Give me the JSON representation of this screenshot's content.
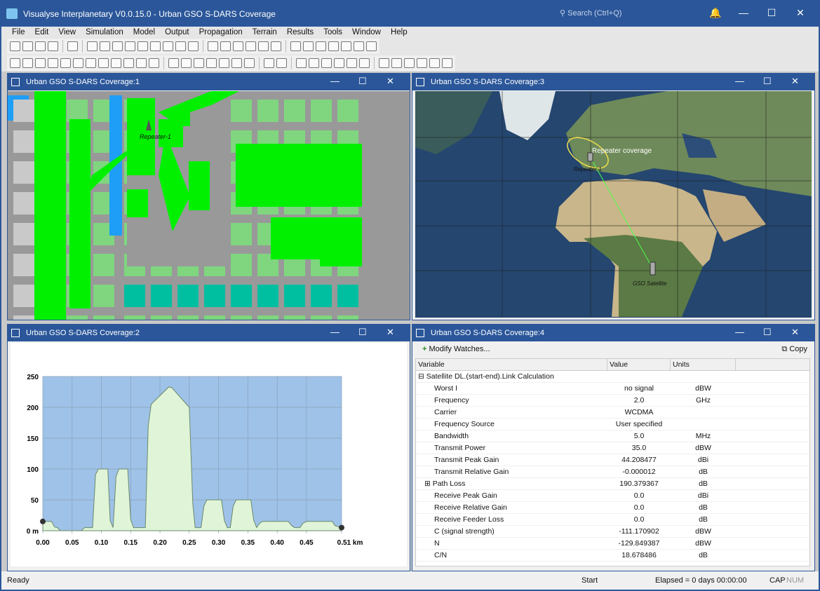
{
  "app": {
    "title": "Visualyse Interplanetary V0.0.15.0 - Urban GSO S-DARS Coverage",
    "search_placeholder": "Search (Ctrl+Q)"
  },
  "menu": [
    "File",
    "Edit",
    "View",
    "Simulation",
    "Model",
    "Output",
    "Propagation",
    "Terrain",
    "Results",
    "Tools",
    "Window",
    "Help"
  ],
  "toolbar1": [
    "new",
    "open",
    "save",
    "save-as",
    "|",
    "copy",
    "|",
    "pane-p",
    "pane-m",
    "pane-globe",
    "pane-network",
    "pane-link",
    "pane-terrain",
    "pane-table",
    "pane-chart",
    "pane-watch",
    "|",
    "select",
    "select-multi",
    "select-box",
    "zoom-in",
    "zoom-out",
    "zoom-fit",
    "|",
    "clock",
    "step-back",
    "stop",
    "step",
    "play",
    "fast-forward",
    "info"
  ],
  "toolbar2": [
    "antenna",
    "station",
    "pattern",
    "beam",
    "link",
    "grid",
    "arrow",
    "network",
    "swap",
    "cloud",
    "dropdown",
    "variable",
    "|",
    "add-station",
    "link-station",
    "link-group",
    "user",
    "user-add",
    "server",
    "server-link",
    "|",
    "sum",
    "add-doc",
    "|",
    "report",
    "filter",
    "add-filter",
    "chart-line",
    "chart-multi",
    "chart-bar",
    "|",
    "terrain",
    "terrain-add",
    "path-add",
    "path-select",
    "building-add",
    "building-filter"
  ],
  "windows": {
    "w1": {
      "title": "Urban GSO S-DARS Coverage:1",
      "repeater_label": "Repeater-1"
    },
    "w3": {
      "title": "Urban GSO S-DARS Coverage:3",
      "coverage_label": "Repeater coverage",
      "station_label": "Repeater-1",
      "satellite_label": "GSO Satellite"
    },
    "w2": {
      "title": "Urban GSO S-DARS Coverage:2"
    },
    "w4": {
      "title": "Urban GSO S-DARS Coverage:4",
      "modify_label": "Modify Watches...",
      "copy_label": "Copy",
      "columns": [
        "Variable",
        "Value",
        "Units"
      ],
      "group": "Satellite DL.(start-end).Link Calculation",
      "rows": [
        [
          "Worst I",
          "no signal",
          "dBW"
        ],
        [
          "Frequency",
          "2.0",
          "GHz"
        ],
        [
          "Carrier",
          "WCDMA",
          ""
        ],
        [
          "Frequency Source",
          "User specified",
          ""
        ],
        [
          "Bandwidth",
          "5.0",
          "MHz"
        ],
        [
          "Transmit Power",
          "35.0",
          "dBW"
        ],
        [
          "Transmit Peak Gain",
          "44.208477",
          "dBi"
        ],
        [
          "Transmit Relative Gain",
          "-0.000012",
          "dB"
        ],
        [
          "Path Loss",
          "190.379367",
          "dB"
        ],
        [
          "Receive Peak Gain",
          "0.0",
          "dBi"
        ],
        [
          "Receive Relative Gain",
          "0.0",
          "dB"
        ],
        [
          "Receive Feeder Loss",
          "0.0",
          "dB"
        ],
        [
          "C (signal strength)",
          "-111.170902",
          "dBW"
        ],
        [
          "N",
          "-129.849387",
          "dBW"
        ],
        [
          "C/N",
          "18.678486",
          "dB"
        ]
      ]
    }
  },
  "chart_data": {
    "type": "area",
    "xlabel_unit": "km",
    "ylabel_unit": "m",
    "xlim": [
      0,
      0.51
    ],
    "ylim": [
      0,
      250
    ],
    "xticks": [
      "0.00",
      "0.05",
      "0.10",
      "0.15",
      "0.20",
      "0.25",
      "0.30",
      "0.35",
      "0.40",
      "0.45",
      "0.51 km"
    ],
    "xtick_values": [
      0,
      0.05,
      0.1,
      0.15,
      0.2,
      0.25,
      0.3,
      0.35,
      0.4,
      0.45,
      0.51
    ],
    "yticks": [
      "0 m",
      "50",
      "100",
      "150",
      "200",
      "250"
    ],
    "ytick_values": [
      0,
      50,
      100,
      150,
      200,
      250
    ],
    "grid": true,
    "x": [
      0,
      0.015,
      0.02,
      0.025,
      0.03,
      0.066,
      0.071,
      0.085,
      0.09,
      0.095,
      0.111,
      0.115,
      0.12,
      0.125,
      0.13,
      0.145,
      0.15,
      0.155,
      0.175,
      0.18,
      0.185,
      0.215,
      0.22,
      0.25,
      0.256,
      0.26,
      0.27,
      0.275,
      0.28,
      0.305,
      0.31,
      0.315,
      0.32,
      0.325,
      0.33,
      0.355,
      0.36,
      0.365,
      0.37,
      0.375,
      0.419,
      0.425,
      0.43,
      0.439,
      0.444,
      0.45,
      0.494,
      0.499,
      0.51
    ],
    "y": [
      15,
      15,
      6,
      5,
      0,
      0,
      5,
      5,
      91,
      100,
      100,
      16,
      5,
      88,
      100,
      100,
      18,
      5,
      5,
      170,
      205,
      233,
      232,
      200,
      44,
      5,
      5,
      40,
      50,
      50,
      16,
      5,
      5,
      40,
      50,
      50,
      17,
      5,
      12,
      15,
      15,
      8,
      5,
      5,
      12,
      15,
      15,
      8,
      5
    ],
    "endpoints": [
      [
        0,
        15
      ],
      [
        0.51,
        5
      ]
    ],
    "colors": {
      "sky": "#9fc2e8",
      "terrain": "#e0f4d8",
      "line": "#6a8a6a"
    }
  },
  "status": {
    "left": "Ready",
    "mid": "Start",
    "elapsed": "Elapsed = 0 days 00:00:00",
    "cap": "CAP",
    "num": "NUM"
  }
}
